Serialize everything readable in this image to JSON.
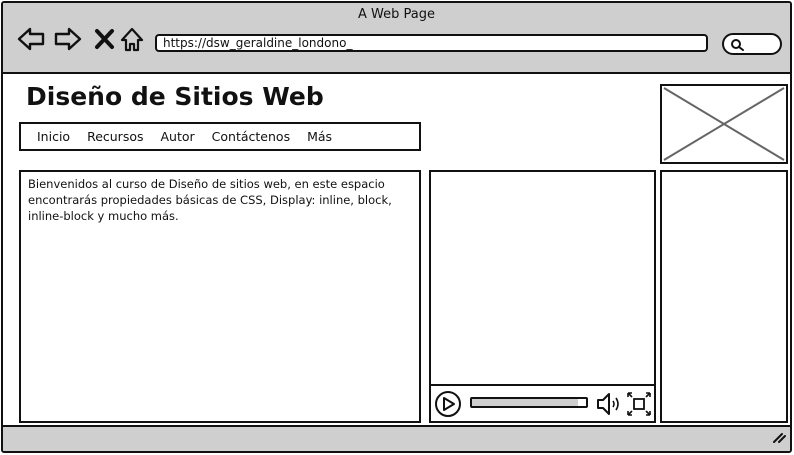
{
  "window": {
    "title": "A Web Page"
  },
  "browser": {
    "icons": [
      "back-arrow-icon",
      "forward-arrow-icon",
      "close-x-icon",
      "home-icon",
      "search-icon"
    ],
    "url": "https://dsw_geraldine_londono_"
  },
  "page": {
    "site_title": "Diseño de Sitios Web",
    "menu": [
      "Inicio",
      "Recursos",
      "Autor",
      "Contáctenos",
      "Más"
    ],
    "content_text": "Bienvenidos al curso de Diseño de sitios web, en este espacio encontrarás propiedades básicas de CSS, Display: inline, block, inline-block y mucho más."
  },
  "video": {
    "icons": [
      "play-icon",
      "volume-icon",
      "fullscreen-icon"
    ],
    "progress": 0.93
  },
  "colors": {
    "chrome": "#cfcfcf",
    "stroke": "#111111",
    "placeholder": "#666666"
  }
}
